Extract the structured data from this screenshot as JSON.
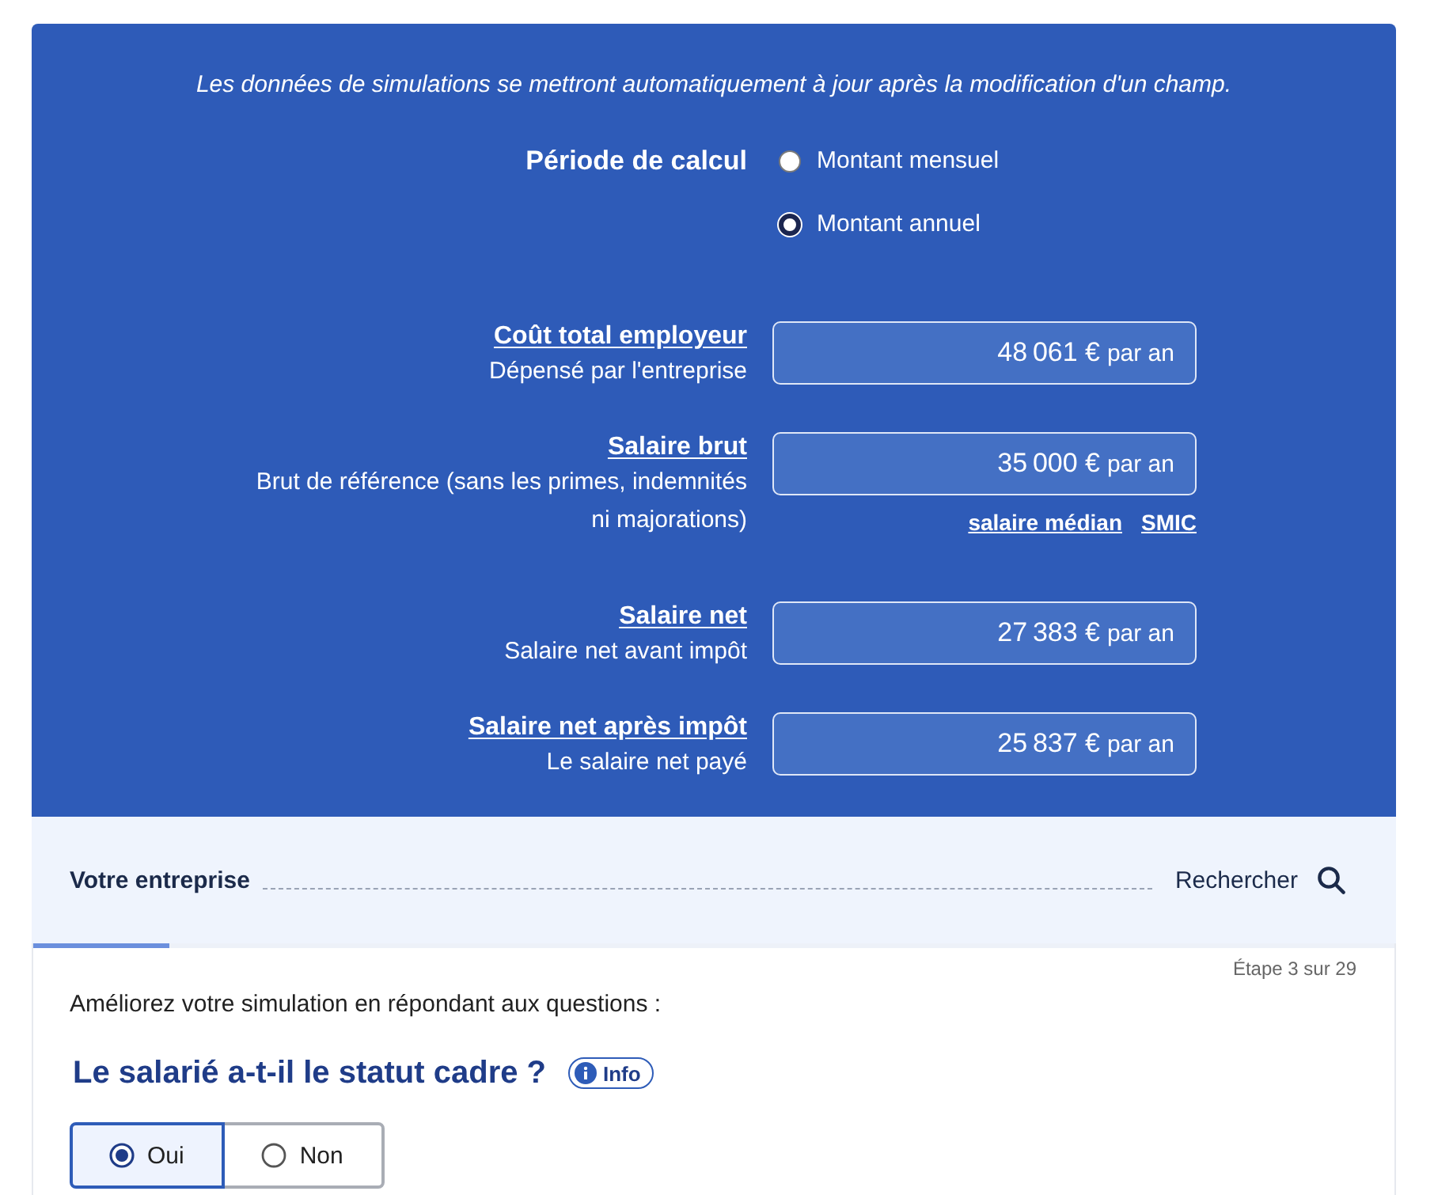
{
  "notice": "Les données de simulations se mettront automatiquement à jour après la modification d'un champ.",
  "period": {
    "label": "Période de calcul",
    "options": [
      {
        "label": "Montant mensuel",
        "selected": false
      },
      {
        "label": "Montant annuel",
        "selected": true
      }
    ]
  },
  "fields": [
    {
      "title": "Coût total employeur",
      "subtitle": "Dépensé par l'entreprise",
      "amount": "48 061 €",
      "unit": "par an"
    },
    {
      "title": "Salaire brut",
      "subtitle": "Brut de référence (sans les primes, indemnités ni majorations)",
      "amount": "35 000 €",
      "unit": "par an",
      "links": [
        "salaire médian",
        "SMIC"
      ]
    },
    {
      "title": "Salaire net",
      "subtitle": "Salaire net avant impôt",
      "amount": "27 383 €",
      "unit": "par an"
    },
    {
      "title": "Salaire net après impôt",
      "subtitle": "Le salaire net payé",
      "amount": "25 837 €",
      "unit": "par an"
    }
  ],
  "company": {
    "label": "Votre entreprise",
    "search": "Rechercher"
  },
  "progress": {
    "level": 0.1,
    "step": "Étape 3 sur 29"
  },
  "intro": "Améliorez votre simulation en répondant aux questions :",
  "question": {
    "title": "Le salarié a-t-il le statut cadre ?",
    "info": "Info",
    "options": [
      {
        "label": "Oui",
        "selected": true
      },
      {
        "label": "Non",
        "selected": false
      }
    ]
  }
}
